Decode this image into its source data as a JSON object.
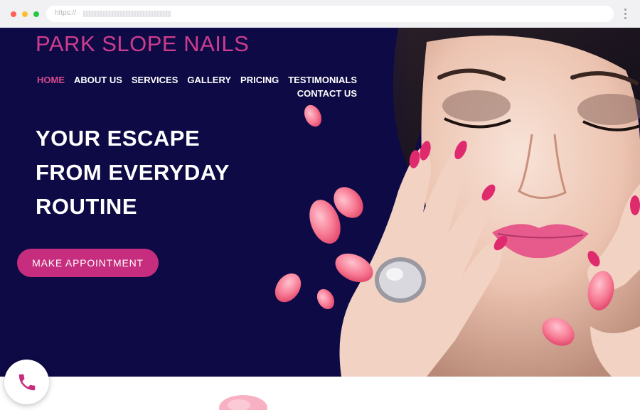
{
  "browser": {
    "url_scheme": "https://",
    "traffic_lights": [
      "close",
      "minimize",
      "maximize"
    ],
    "menu_icon": "kebab-menu-icon"
  },
  "site": {
    "brand": "PARK SLOPE NAILS",
    "nav": [
      {
        "label": "HOME",
        "active": true
      },
      {
        "label": "ABOUT US",
        "active": false
      },
      {
        "label": "SERVICES",
        "active": false
      },
      {
        "label": "GALLERY",
        "active": false
      },
      {
        "label": "PRICING",
        "active": false
      },
      {
        "label": "TESTIMONIALS",
        "active": false
      },
      {
        "label": "CONTACT US",
        "active": false
      }
    ],
    "headline": [
      "YOUR ESCAPE",
      "FROM EVERYDAY",
      "ROUTINE"
    ],
    "cta_label": "MAKE APPOINTMENT",
    "phone_icon": "phone-icon"
  },
  "colors": {
    "hero_bg": "#0d0a45",
    "brand": "#cf3c8e",
    "nav_active": "#d84a8e",
    "cta": "#c72d7e",
    "phone_icon": "#c72d7e"
  }
}
